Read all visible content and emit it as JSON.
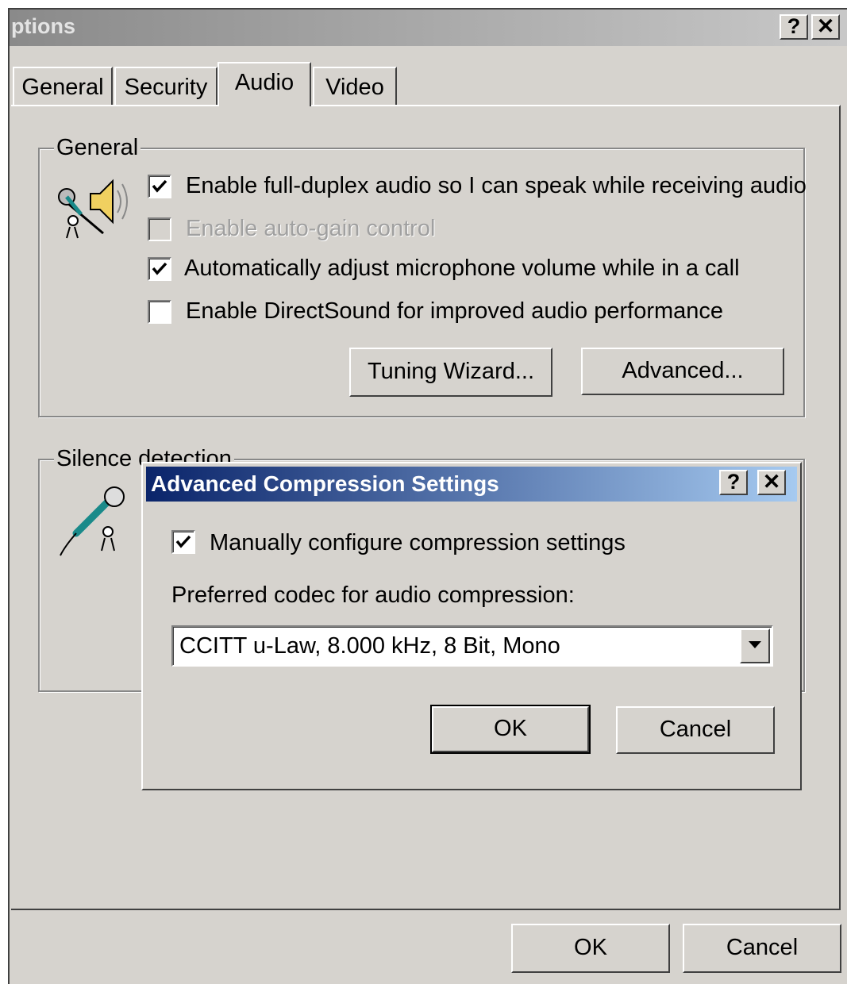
{
  "window": {
    "title": "ptions",
    "help_label": "?",
    "close_label": "✕"
  },
  "tabs": [
    {
      "label": "General"
    },
    {
      "label": "Security"
    },
    {
      "label": "Audio"
    },
    {
      "label": "Video"
    }
  ],
  "general_group": {
    "label": "General",
    "icon": "speaker-microphone-icon",
    "options": [
      {
        "label": "Enable full-duplex audio so I can speak while receiving audio",
        "checked": true,
        "enabled": true
      },
      {
        "label": "Enable auto-gain control",
        "checked": false,
        "enabled": false
      },
      {
        "label": "Automatically adjust microphone volume while in a call",
        "checked": true,
        "enabled": true
      },
      {
        "label": "Enable DirectSound for improved audio performance",
        "checked": false,
        "enabled": true
      }
    ],
    "tuning_wizard_label": "Tuning Wizard...",
    "advanced_label": "Advanced..."
  },
  "silence_group": {
    "label": "Silence detection",
    "icon": "microphone-icon"
  },
  "dialog": {
    "title": "Advanced Compression Settings",
    "help_label": "?",
    "close_label": "✕",
    "manual_label": "Manually configure compression settings",
    "manual_checked": true,
    "codec_label": "Preferred codec for audio compression:",
    "codec_value": "CCITT u-Law, 8.000 kHz, 8 Bit, Mono",
    "ok_label": "OK",
    "cancel_label": "Cancel"
  },
  "footer": {
    "ok_label": "OK",
    "cancel_label": "Cancel"
  },
  "colors": {
    "face": "#d6d3ce",
    "dialog_title_start": "#0a246a",
    "dialog_title_end": "#a6caf0"
  }
}
